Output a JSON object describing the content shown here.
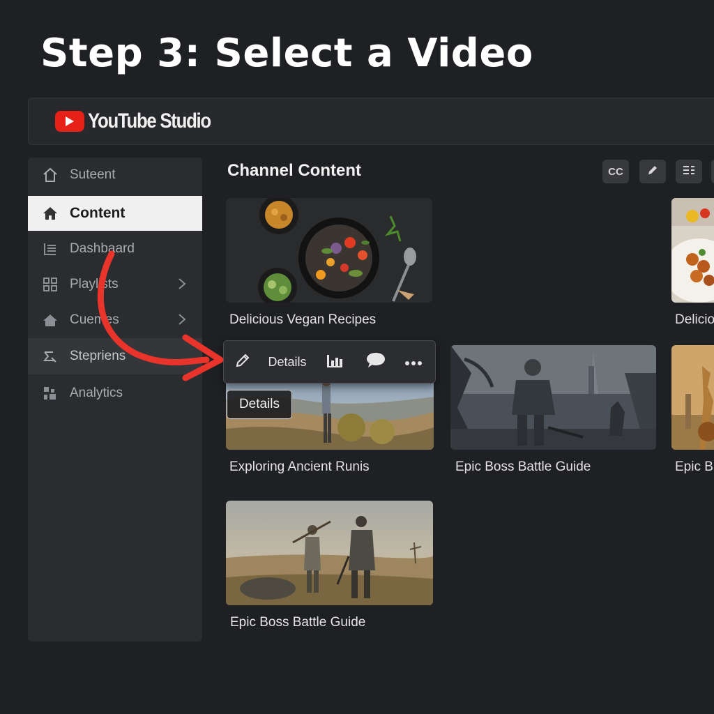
{
  "step_title": "Step 3: Select a Video",
  "app": {
    "name": "YouTube Studio"
  },
  "sidebar": {
    "items": [
      {
        "label": "Suteent",
        "icon": "home-icon"
      },
      {
        "label": "Content",
        "icon": "home-filled-icon",
        "active": true
      },
      {
        "label": "Dashbaard",
        "icon": "list-icon"
      },
      {
        "label": "Playlists",
        "icon": "grid-icon",
        "has_chevron": true
      },
      {
        "label": "Cuemes",
        "icon": "house-icon",
        "has_chevron": true
      },
      {
        "label": "Stepriens",
        "icon": "wrench-icon"
      },
      {
        "label": "Analytics",
        "icon": "analytics-icon"
      }
    ]
  },
  "main": {
    "title": "Channel Content",
    "tools": [
      {
        "label": "CC",
        "icon": "cc-icon"
      },
      {
        "label": "",
        "icon": "pencil-icon"
      },
      {
        "label": "",
        "icon": "filter-icon"
      }
    ],
    "hover_toolbar": {
      "details_label": "Details",
      "icons": [
        "pencil-icon",
        "analytics-icon",
        "comment-icon",
        "more-icon"
      ]
    },
    "details_badge": "Details",
    "videos": [
      {
        "title": "Delicious Vegan Recipes"
      },
      {
        "title": "Delicio"
      },
      {
        "title": "Exploring Ancient Runis"
      },
      {
        "title": "Epic Boss Battle Guide"
      },
      {
        "title": "Epic B"
      },
      {
        "title": "Epic Boss Battle Guide"
      }
    ]
  },
  "colors": {
    "background": "#1f2023",
    "accent_red": "#e62117",
    "arrow_red": "#e8342a",
    "active_nav": "#f0f0f0"
  }
}
